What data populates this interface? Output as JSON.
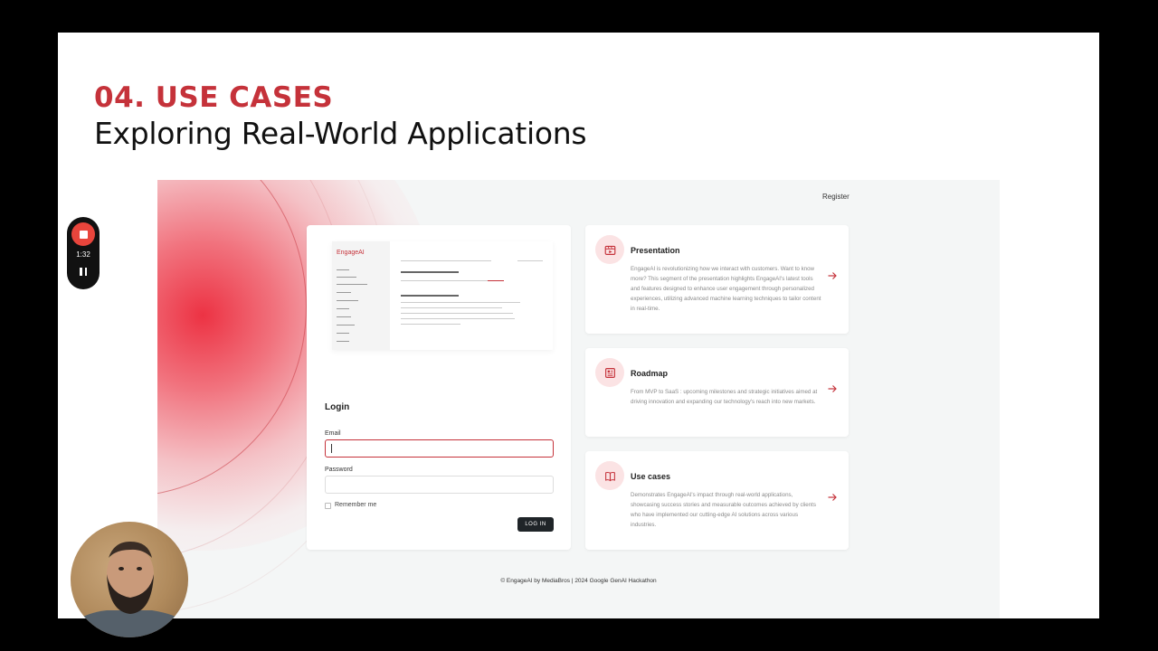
{
  "slide": {
    "number_title": "04. USE CASES",
    "subtitle": "Exploring Real-World Applications"
  },
  "app": {
    "register_label": "Register",
    "preview_logo": "EngageAI",
    "login": {
      "title": "Login",
      "email_label": "Email",
      "email_value": "",
      "password_label": "Password",
      "password_value": "",
      "remember_label": "Remember me",
      "button_label": "LOG IN"
    },
    "cards": [
      {
        "title": "Presentation",
        "icon": "video-icon",
        "text": "EngageAI is revolutionizing how we interact with customers. Want to know more? This segment of the presentation highlights EngageAI's latest tools and features designed to enhance user engagement through personalized experiences, utilizing advanced machine learning techniques to tailor content in real-time."
      },
      {
        "title": "Roadmap",
        "icon": "document-icon",
        "text": "From MVP to SaaS : upcoming milestones and strategic initiatives aimed at driving innovation and expanding our technology's reach into new markets."
      },
      {
        "title": "Use cases",
        "icon": "book-icon",
        "text": "Demonstrates EngageAI's impact through real-world applications, showcasing success stories and measurable outcomes achieved by clients who have implemented our cutting-edge AI solutions across various industries."
      }
    ],
    "footer": "© EngageAI by MediaBros | 2024 Google GenAI Hackathon"
  },
  "recorder": {
    "time": "1:32"
  },
  "colors": {
    "accent": "#c5323a",
    "button_dark": "#1f2428",
    "app_bg": "#f4f6f6"
  }
}
